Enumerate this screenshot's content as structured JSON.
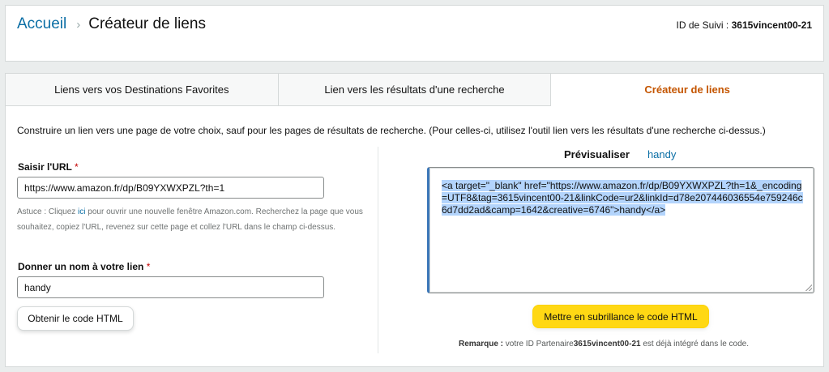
{
  "header": {
    "breadcrumb_home": "Accueil",
    "breadcrumb_separator": "›",
    "breadcrumb_current": "Créateur de liens",
    "tracking_label": "ID de Suivi :",
    "tracking_id": "3615vincent00-21"
  },
  "tabs": [
    {
      "label": "Liens vers vos Destinations Favorites",
      "active": false
    },
    {
      "label": "Lien vers les résultats d'une recherche",
      "active": false
    },
    {
      "label": "Créateur de liens",
      "active": true
    }
  ],
  "intro": "Construire un lien vers une page de votre choix, sauf pour les pages de résultats de recherche. (Pour celles-ci, utilisez l'outil lien vers les résultats d'une recherche ci-dessus.)",
  "url_field": {
    "label": "Saisir l'URL",
    "required_mark": "*",
    "value": "https://www.amazon.fr/dp/B09YXWXPZL?th=1"
  },
  "hint": {
    "prefix": "Astuce : Cliquez ",
    "link": "ici",
    "suffix": " pour ouvrir une nouvelle fenêtre Amazon.com. Recherchez la page que vous souhaitez, copiez l'URL, revenez sur cette page et collez l'URL dans le champ ci-dessus."
  },
  "name_field": {
    "label": "Donner un nom à votre lien",
    "required_mark": "*",
    "value": "handy"
  },
  "get_html_button": "Obtenir le code HTML",
  "preview": {
    "label": "Prévisualiser",
    "link_text": "handy"
  },
  "code": "<a target=\"_blank\" href=\"https://www.amazon.fr/dp/B09YXWXPZL?th=1&_encoding=UTF8&tag=3615vincent00-21&linkCode=ur2&linkId=d78e207446036554e759246c6d7dd2ad&camp=1642&creative=6746\">handy</a>",
  "highlight_button": "Mettre en subrillance le code HTML",
  "remark": {
    "label": "Remarque :",
    "prefix": " votre ID Partenaire",
    "id": "3615vincent00-21",
    "suffix": " est déjà intégré dans le code."
  }
}
